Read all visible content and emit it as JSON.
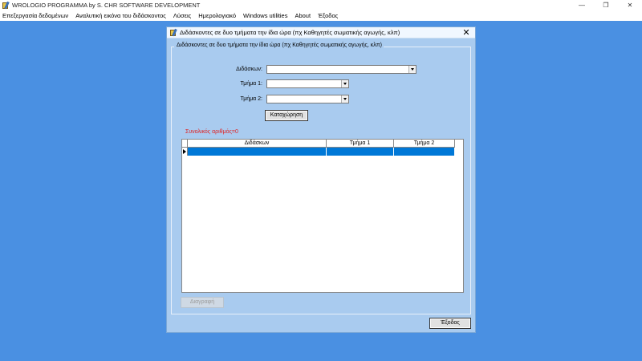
{
  "app": {
    "title": "WROLOGIO PROGRAMMA by S. CHR SOFTWARE DEVELOPMENT",
    "minimize": "—",
    "restore": "❐",
    "close": "✕"
  },
  "menu": [
    {
      "label": "Επεξεργασία δεδομένων"
    },
    {
      "label": "Αναλυτική εικόνα του διδάσκοντος"
    },
    {
      "label": "Λύσεις"
    },
    {
      "label": "Ημερολογιακό"
    },
    {
      "label": "Windows utilities"
    },
    {
      "label": "About"
    },
    {
      "label": "Έξοδος"
    }
  ],
  "dialog": {
    "title": "Διδάσκοντες σε δυο τμήματα την ίδια ώρα (πχ Καθηγητές σωματικής αγωγής, κλπ)",
    "close": "✕",
    "group_label": "Διδάσκοντες σε δυο τμήματα την ίδια ώρα (πχ Καθηγητές σωματικής αγωγής, κλπ)",
    "fields": {
      "teacher_label": "Διδάσκων:",
      "teacher_value": "",
      "section1_label": "Τμήμα 1:",
      "section1_value": "",
      "section2_label": "Τμήμα 2:",
      "section2_value": ""
    },
    "register_button": "Καταχώρηση",
    "total_text": "Συνολικός αριθμός=0",
    "grid": {
      "columns": [
        "Διδάσκων",
        "Τμήμα 1",
        "Τμήμα 2"
      ],
      "rows": []
    },
    "delete_button": "Διαγραφή",
    "exit_button": "Έξοδος"
  },
  "colors": {
    "desktop": "#4a90e2",
    "dialog_bg": "#a9cbef",
    "selection": "#0078d7",
    "total_text": "#e02020"
  }
}
